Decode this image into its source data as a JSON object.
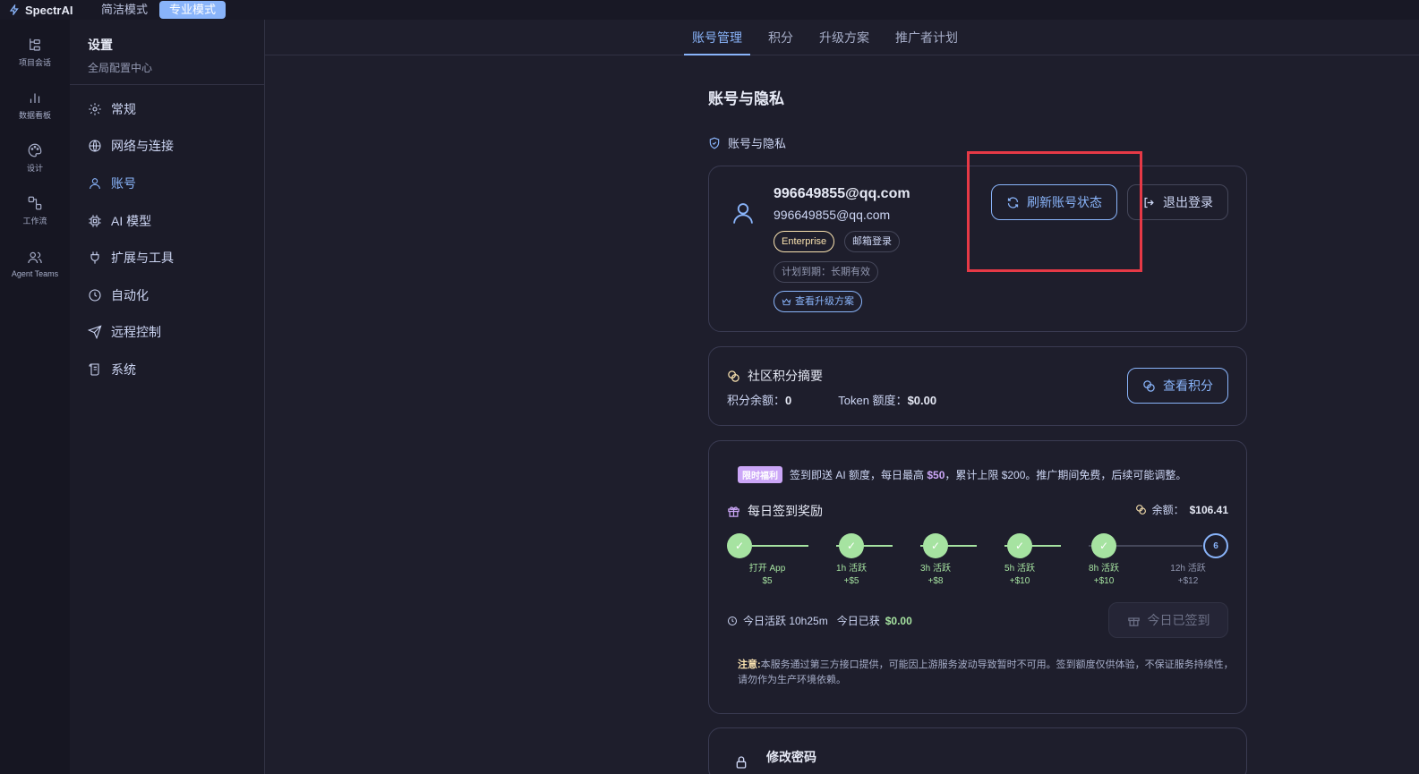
{
  "app": {
    "name": "SpectrAI",
    "modes": [
      "简洁模式",
      "专业模式"
    ],
    "active_mode": "专业模式"
  },
  "rail": [
    {
      "icon": "project-tree-icon",
      "label": "项目会话"
    },
    {
      "icon": "bar-chart-icon",
      "label": "数据看板"
    },
    {
      "icon": "palette-icon",
      "label": "设计"
    },
    {
      "icon": "workflow-icon",
      "label": "工作流"
    },
    {
      "icon": "users-icon",
      "label": "Agent Teams"
    }
  ],
  "sidebar": {
    "title": "设置",
    "subtitle": "全局配置中心",
    "items": [
      {
        "icon": "gear-icon",
        "label": "常规"
      },
      {
        "icon": "globe-icon",
        "label": "网络与连接"
      },
      {
        "icon": "user-icon",
        "label": "账号",
        "active": true
      },
      {
        "icon": "chip-icon",
        "label": "AI 模型"
      },
      {
        "icon": "plug-icon",
        "label": "扩展与工具"
      },
      {
        "icon": "clock-icon",
        "label": "自动化"
      },
      {
        "icon": "send-icon",
        "label": "远程控制"
      },
      {
        "icon": "scroll-icon",
        "label": "系统"
      }
    ]
  },
  "tabs": [
    "账号管理",
    "积分",
    "升级方案",
    "推广者计划"
  ],
  "active_tab": "账号管理",
  "section_title": "账号与隐私",
  "subhead": "账号与隐私",
  "account": {
    "email_main": "996649855@qq.com",
    "email_sub": "996649855@qq.com",
    "plan_badge": "Enterprise",
    "login_badge": "邮箱登录",
    "expiry": "计划到期：长期有效",
    "upgrade_link": "查看升级方案",
    "refresh_button": "刷新账号状态",
    "logout_button": "退出登录"
  },
  "points": {
    "title": "社区积分摘要",
    "balance_label": "积分余额：",
    "balance_value": "0",
    "token_label": "Token 额度：",
    "token_value": "$0.00",
    "view_button": "查看积分"
  },
  "checkin": {
    "promo_badge": "限时福利",
    "promo_text_1": "签到即送 AI 额度，每日最高 ",
    "promo_highlight": "$50",
    "promo_text_2": "，累计上限 $200。推广期间免费，后续可能调整。",
    "title": "每日签到奖励",
    "balance_label": "余额：",
    "balance_value": "$106.41",
    "steps": [
      {
        "mark": "✓",
        "label": "打开 App",
        "reward": "$5",
        "done": true
      },
      {
        "mark": "✓",
        "label": "1h 活跃",
        "reward": "+$5",
        "done": true
      },
      {
        "mark": "✓",
        "label": "3h 活跃",
        "reward": "+$8",
        "done": true
      },
      {
        "mark": "✓",
        "label": "5h 活跃",
        "reward": "+$10",
        "done": true
      },
      {
        "mark": "✓",
        "label": "8h 活跃",
        "reward": "+$10",
        "done": true
      },
      {
        "mark": "6",
        "label": "12h 活跃",
        "reward": "+$12",
        "done": false
      }
    ],
    "active_text": "今日活跃 10h25m",
    "earned_label": "今日已获",
    "earned_value": "$0.00",
    "checked_button": "今日已签到",
    "notice_label": "注意:",
    "notice_text": "本服务通过第三方接口提供，可能因上游服务波动导致暂时不可用。签到额度仅供体验，不保证服务持续性，请勿作为生产环境依赖。"
  },
  "password": {
    "title": "修改密码"
  },
  "colors": {
    "accent": "#89b4fa",
    "success": "#a6e3a1",
    "highlight": "#e63946",
    "purple": "#cba6f7",
    "gold": "#f9e2af"
  }
}
